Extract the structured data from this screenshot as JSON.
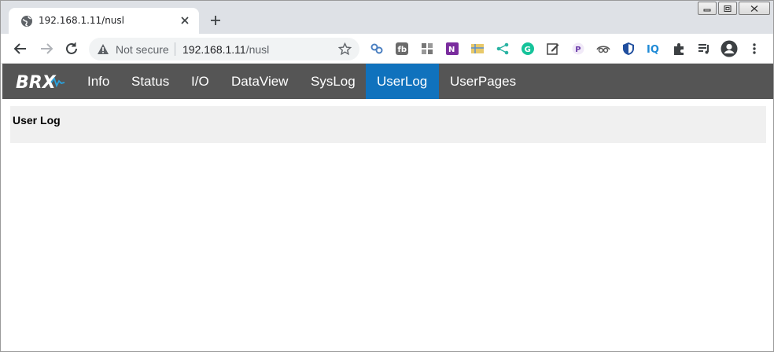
{
  "browser": {
    "tab": {
      "title": "192.168.1.11/nusl"
    },
    "omnibox": {
      "security_label": "Not secure",
      "url_host": "192.168.1.11",
      "url_path": "/nusl"
    },
    "extensions": [
      "link-icon",
      "fb-icon",
      "qr-icon",
      "onenote-icon",
      "map-icon",
      "share-icon",
      "grammarly-icon",
      "edit-icon",
      "p-icon",
      "eye-icon",
      "shield-icon",
      "iq-icon",
      "puzzle-icon",
      "media-icon"
    ]
  },
  "app": {
    "logo_text": "BRX",
    "nav": [
      {
        "label": "Info",
        "active": false
      },
      {
        "label": "Status",
        "active": false
      },
      {
        "label": "I/O",
        "active": false
      },
      {
        "label": "DataView",
        "active": false
      },
      {
        "label": "SysLog",
        "active": false
      },
      {
        "label": "UserLog",
        "active": true
      },
      {
        "label": "UserPages",
        "active": false
      }
    ],
    "page_heading": "User Log"
  },
  "colors": {
    "nav_bg": "#555555",
    "nav_active": "#1072bd",
    "panel_bg": "#f0f0f0",
    "tabstrip_bg": "#dee1e6"
  }
}
